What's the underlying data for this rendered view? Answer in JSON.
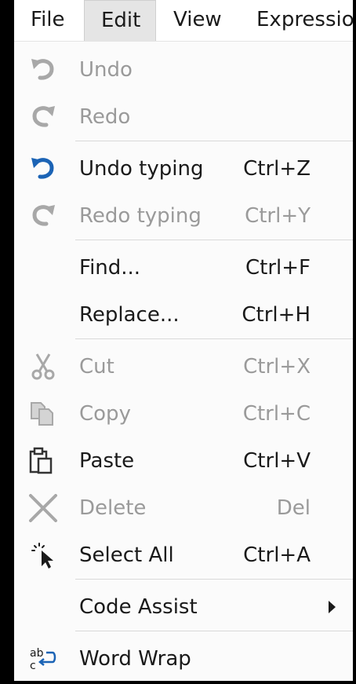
{
  "menubar": {
    "items": [
      {
        "label": "File",
        "active": false
      },
      {
        "label": "Edit",
        "active": true
      },
      {
        "label": "View",
        "active": false
      },
      {
        "label": "Expressio",
        "active": false
      }
    ]
  },
  "edit_menu": {
    "items": [
      {
        "label": "Undo",
        "shortcut": "",
        "icon": "undo-icon",
        "enabled": false
      },
      {
        "label": "Redo",
        "shortcut": "",
        "icon": "redo-icon",
        "enabled": false
      },
      {
        "label": "Undo typing",
        "shortcut": "Ctrl+Z",
        "icon": "undo-icon",
        "enabled": true
      },
      {
        "label": "Redo typing",
        "shortcut": "Ctrl+Y",
        "icon": "redo-icon",
        "enabled": false
      },
      {
        "label": "Find...",
        "shortcut": "Ctrl+F",
        "icon": "",
        "enabled": true
      },
      {
        "label": "Replace...",
        "shortcut": "Ctrl+H",
        "icon": "",
        "enabled": true
      },
      {
        "label": "Cut",
        "shortcut": "Ctrl+X",
        "icon": "scissors-icon",
        "enabled": false
      },
      {
        "label": "Copy",
        "shortcut": "Ctrl+C",
        "icon": "copy-icon",
        "enabled": false
      },
      {
        "label": "Paste",
        "shortcut": "Ctrl+V",
        "icon": "clipboard-icon",
        "enabled": true
      },
      {
        "label": "Delete",
        "shortcut": "Del",
        "icon": "delete-x-icon",
        "enabled": false
      },
      {
        "label": "Select All",
        "shortcut": "Ctrl+A",
        "icon": "select-all-cursor-icon",
        "enabled": true
      },
      {
        "label": "Code Assist",
        "shortcut": "",
        "icon": "",
        "enabled": true,
        "has_submenu": true
      },
      {
        "label": "Word Wrap",
        "shortcut": "",
        "icon": "word-wrap-icon",
        "enabled": true
      }
    ]
  },
  "icon_word_wrap": {
    "top_text": "ab",
    "bottom_text": "c"
  },
  "colors": {
    "accent_icon": "#1b63b5",
    "disabled_icon": "#a8a8a8",
    "disabled_text": "#9a9a9a",
    "text": "#1a1a1a",
    "menu_background": "#fbfbfb",
    "active_menubar": "#e5e5e5"
  }
}
